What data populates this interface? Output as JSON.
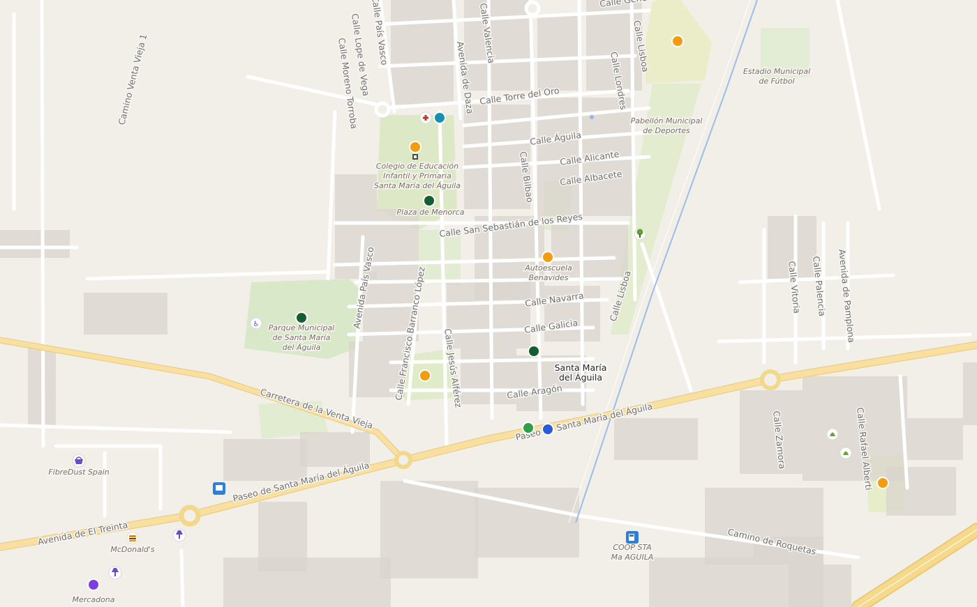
{
  "map": {
    "town": "Santa María\ndel Águila",
    "streets": [
      "Calle Generalife",
      "Calle Lisboa",
      "Calle País Vasco",
      "Calle Lope de Vega",
      "Calle Moreno Torroba",
      "Calle Valencia",
      "Avenida de Daza",
      "Calle Torre del Oro",
      "Calle Águila",
      "Calle Londres",
      "Calle Alicante",
      "Calle Albacete",
      "Calle Bilbao",
      "Calle San Sebastián de los Reyes",
      "Calle Navarra",
      "Calle Galicia",
      "Calle Aragón",
      "Calle Francisco Barranco López",
      "Calle Jesús Alférez",
      "Avenida País Vasco",
      "Carretera de la Venta Vieja",
      "Paseo de Santa María del Águila",
      "Avenida de El Treinta",
      "Camino Venta Vieja 1",
      "Camino de Roquetas",
      "Calle Vitoria",
      "Calle Palencia",
      "Avenida de Pamplona",
      "Calle Zamora",
      "Calle Rafael Alberti"
    ],
    "places": [
      "Estadio Municipal\nde Fútbol",
      "Pabellón Municipal\nde Deportes",
      "Colegio de Educación\nInfantil y Primaria\nSanta María del Águila",
      "Plaza de Menorca",
      "Autoescuela\nBenavides",
      "Parque Municipal\nde Santa María\ndel Águila",
      "FibreDust Spain",
      "McDonald's",
      "Mercadona",
      "COOP STA\nMa AGUILA"
    ],
    "colors": {
      "background": "#f2efe9",
      "major_road": "#f7d98b",
      "park": "#dbe9c9",
      "building": "#d9d4cd",
      "marker_orange": "#f29c11",
      "marker_darkgreen": "#155e32",
      "marker_teal": "#1b8fb3",
      "marker_blue": "#2a5cd9",
      "marker_green": "#2ca04a",
      "marker_purple": "#7b3fe0",
      "railway": "#8fb4e6"
    },
    "markers": [
      {
        "name": "marker-orange-icon",
        "color": "marker_orange"
      },
      {
        "name": "marker-dark-green-icon",
        "color": "marker_darkgreen"
      },
      {
        "name": "marker-teal-icon",
        "color": "marker_teal"
      },
      {
        "name": "marker-blue-icon",
        "color": "marker_blue"
      },
      {
        "name": "marker-green-icon",
        "color": "marker_green"
      },
      {
        "name": "marker-purple-icon",
        "color": "marker_purple"
      }
    ]
  }
}
